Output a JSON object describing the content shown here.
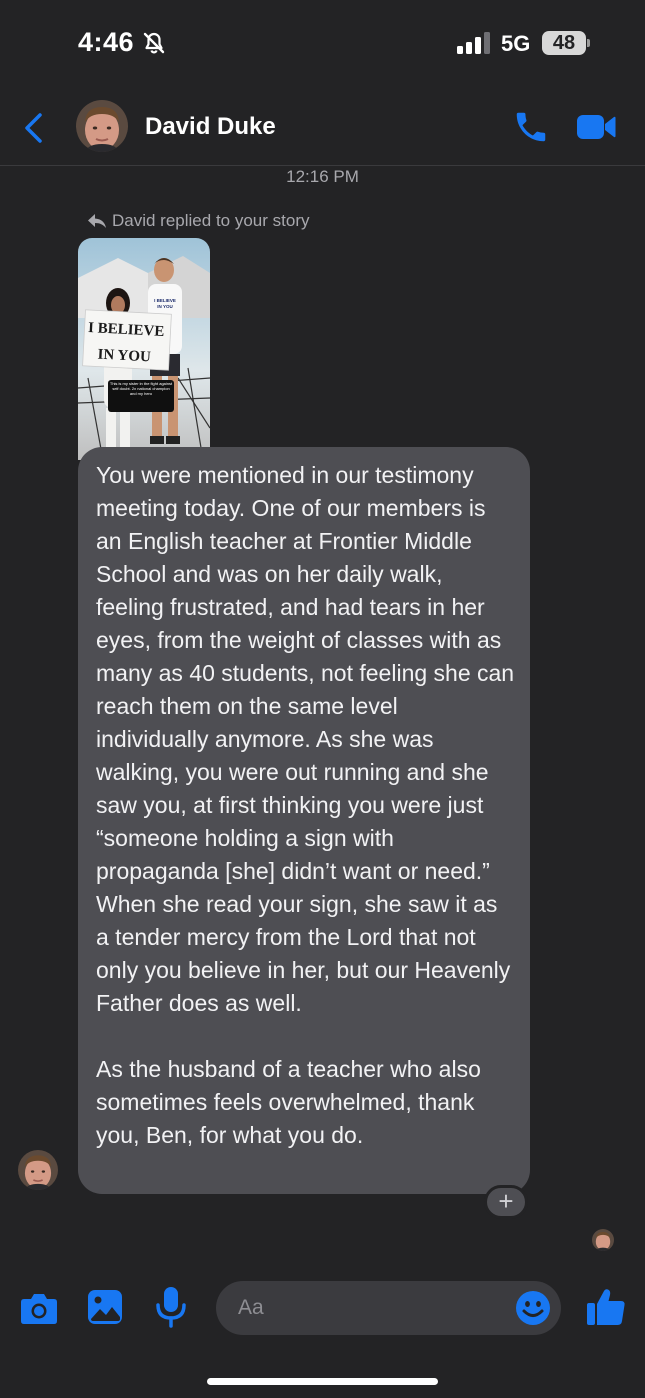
{
  "status_bar": {
    "time": "4:46",
    "network": "5G",
    "battery": "48"
  },
  "header": {
    "contact_name": "David Duke"
  },
  "conversation": {
    "timestamp": "12:16 PM",
    "reply_note": "David replied to your story",
    "story_preview": {
      "sign_line_1": "I BELIEVE",
      "sign_line_2": "IN YOU",
      "caption": "This is my sister in the fight against self doubt. 2x national champion and my hero",
      "shirt_text": "I BELIEVE IN YOU"
    },
    "message": "You were mentioned in our testimony meeting today. One of our members is an English teacher at Frontier Middle School and was on her daily walk, feeling frustrated,  and had tears in her eyes, from the weight of classes with as many as 40 students, not feeling she can reach them on the same level individually anymore. As she was walking, you were out running and she saw you, at first thinking you were just “someone holding a sign with propaganda [she] didn’t want or need.” When she read your sign, she saw it as a tender mercy from the Lord that not only you believe in her, but our Heavenly Father does as well.\n\nAs the husband of a teacher who also sometimes feels overwhelmed, thank you, Ben, for what you do.",
    "react_label": "+"
  },
  "composer": {
    "placeholder": "Aa"
  },
  "colors": {
    "background": "#232325",
    "accent": "#1877f2",
    "bubble": "#4e4e53",
    "secondary_text": "#a8a8ad"
  }
}
